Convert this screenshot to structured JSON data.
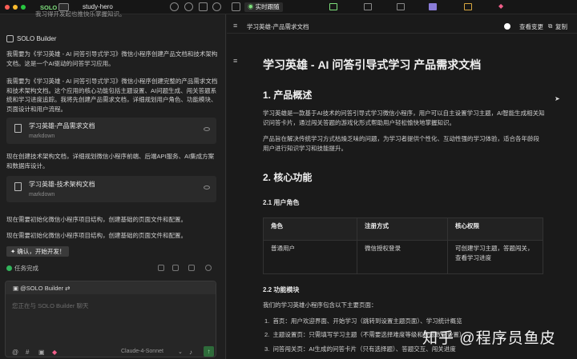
{
  "topbar": {
    "solo_label": "SOLO",
    "project": "study-hero"
  },
  "left": {
    "top_cut_text": "我习得开发起也推快乐掌握知识。",
    "builder_name": "SOLO Builder",
    "msg1": "我需要为《学习英雄 - AI 问答引导式学习》微信小程序创建产品文档和技术架构文档。这是一个AI驱动的问答学习应用。",
    "msg2": "我需要为《学习英雄 - AI 问答引导式学习》微信小程序创建完整的产品需求文档和技术架构文档。这个应用的核心功能包括主题设置、AI问题生成、闯关答题系统和学习进度追踪。我将先创建产品需求文档，详细规划用户角色、功能模块、页面设计和用户流程。",
    "card1": {
      "title": "学习英雄-产品需求文档",
      "sub": "markdown"
    },
    "msg3": "现在创建技术架构文档，详细规划微信小程序前端、后端API服务、AI集成方案和数据库设计。",
    "card2": {
      "title": "学习英雄-技术架构文档",
      "sub": "markdown"
    },
    "msg4": "现在需要初始化微信小程序项目结构，创建基础的页面文件和配置。",
    "msg5": "现在需要初始化微信小程序项目结构，创建基础的页面文件和配置。",
    "confirm_label": "确认，开始开发！",
    "task_done": "任务完成",
    "mention": "@SOLO Builder",
    "placeholder": "您正在与 SOLO Builder 聊天",
    "model": "Claude-4-Sonnet"
  },
  "right": {
    "live_tab": "实时跟随",
    "file_title": "学习英雄-产品需求文档",
    "view_changes": "查看变更",
    "copy": "复制",
    "h1": "学习英雄 - AI 问答引导式学习 产品需求文档",
    "s1": "1. 产品概述",
    "p1": "学习英雄是一款基于AI技术的问答引导式学习微信小程序，用户可以自主设置学习主题，AI智能生成相关知识问答卡片，通过闯关答题的游戏化形式帮助用户轻松愉快地掌握知识。",
    "p2": "产品旨在解决传统学习方式枯燥乏味的问题，为学习者提供个性化、互动性强的学习体验，适合各年龄段用户进行知识学习和技能提升。",
    "s2": "2. 核心功能",
    "s21": "2.1 用户角色",
    "table": {
      "headers": [
        "角色",
        "注册方式",
        "核心权限"
      ],
      "row": [
        "普通用户",
        "微信授权登录",
        "可创建学习主题，答题闯关，查看学习进度"
      ]
    },
    "s22": "2.2 功能模块",
    "intro": "我们的学习英雄小程序包含以下主要页面：",
    "items": [
      "首页：用户欢迎界面、开始学习（跳转到设置主题页面）、学习统计概览",
      "主题设置页：只需填写学习主题（不需要选择难度等级和答题数量设置）",
      "问答闯关页：AI生成的问答卡片（只有选择题）、答题交互、闯关进度"
    ],
    "watermark": "知乎 @程序员鱼皮"
  },
  "colors": {
    "green": "#32b45b",
    "bg": "#1a1a1a"
  }
}
